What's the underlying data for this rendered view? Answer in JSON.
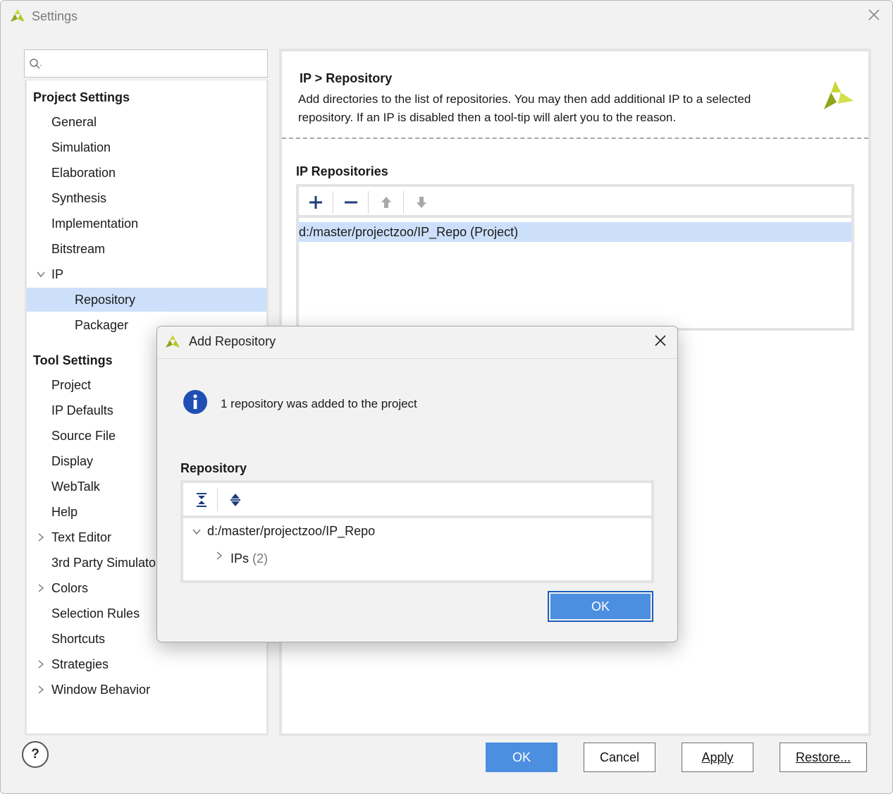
{
  "window": {
    "title": "Settings"
  },
  "search": {
    "placeholder": ""
  },
  "nav": {
    "project_header": "Project Settings",
    "project_items": [
      "General",
      "Simulation",
      "Elaboration",
      "Synthesis",
      "Implementation",
      "Bitstream"
    ],
    "ip_label": "IP",
    "ip_children": [
      "Repository",
      "Packager"
    ],
    "selected": "Repository",
    "tool_header": "Tool Settings",
    "tool_items": [
      "Project",
      "IP Defaults",
      "Source File",
      "Display",
      "WebTalk",
      "Help",
      "Text Editor",
      "3rd Party Simulators",
      "Colors",
      "Selection Rules",
      "Shortcuts",
      "Strategies",
      "Window Behavior"
    ],
    "expandable": [
      "Text Editor",
      "Colors",
      "Strategies",
      "Window Behavior"
    ]
  },
  "content": {
    "breadcrumb": "IP > Repository",
    "description": "Add directories to the list of repositories. You may then add additional IP to a selected repository. If an IP is disabled then a tool-tip will alert you to the reason.",
    "section_label": "IP Repositories",
    "toolbar_icons": [
      "add-icon",
      "remove-icon",
      "move-up-icon",
      "move-down-icon"
    ],
    "repositories": [
      {
        "path": "d:/master/projectzoo/IP_Repo (Project)"
      }
    ]
  },
  "buttons": {
    "help": "?",
    "ok": "OK",
    "cancel": "Cancel",
    "apply": "Apply",
    "restore": "Restore..."
  },
  "dialog": {
    "title": "Add Repository",
    "message": "1 repository was added to the project",
    "section_label": "Repository",
    "toolbar_icons": [
      "collapse-all-icon",
      "expand-all-icon"
    ],
    "tree_root": "d:/master/projectzoo/IP_Repo",
    "tree_child_label": "IPs",
    "tree_child_count": "(2)",
    "ok": "OK"
  },
  "colors": {
    "selection": "#cde0fb",
    "primary_button": "#4c8ee0",
    "info_icon": "#1f4fb4",
    "logo_green": "#9cb21c"
  }
}
